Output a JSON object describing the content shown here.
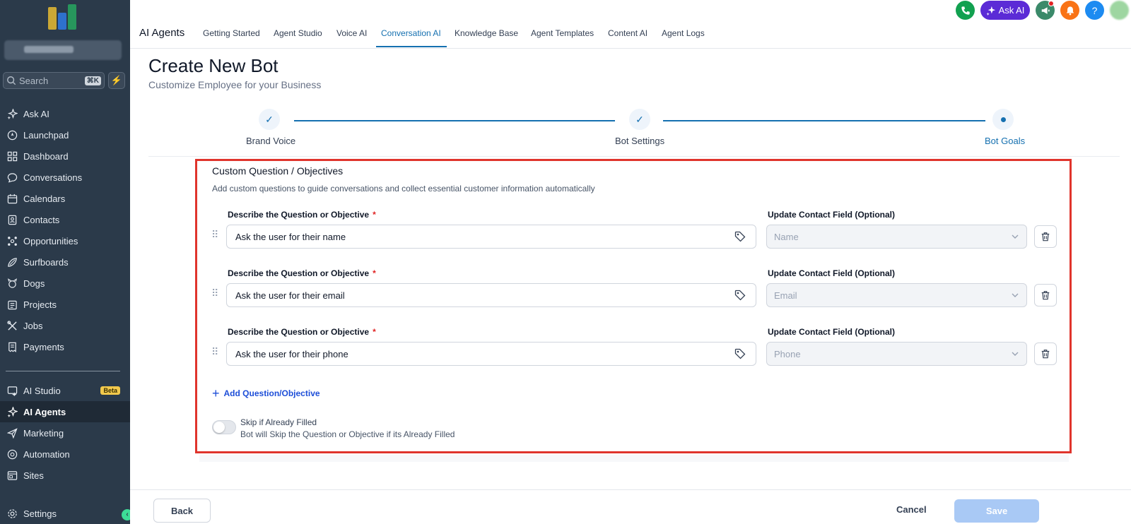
{
  "sidebar": {
    "search_placeholder": "Search",
    "search_shortcut": "⌘K",
    "items": [
      {
        "label": "Ask AI",
        "icon": "sparkle-icon"
      },
      {
        "label": "Launchpad",
        "icon": "rocket-icon"
      },
      {
        "label": "Dashboard",
        "icon": "dashboard-icon"
      },
      {
        "label": "Conversations",
        "icon": "chat-icon"
      },
      {
        "label": "Calendars",
        "icon": "calendar-icon"
      },
      {
        "label": "Contacts",
        "icon": "contacts-icon"
      },
      {
        "label": "Opportunities",
        "icon": "opportunities-icon"
      },
      {
        "label": "Surfboards",
        "icon": "surfboard-icon"
      },
      {
        "label": "Dogs",
        "icon": "dog-icon"
      },
      {
        "label": "Projects",
        "icon": "projects-icon"
      },
      {
        "label": "Jobs",
        "icon": "tools-icon"
      },
      {
        "label": "Payments",
        "icon": "receipt-icon"
      },
      {
        "label": "AI Studio",
        "icon": "ai-studio-icon",
        "badge": "Beta"
      },
      {
        "label": "AI Agents",
        "icon": "sparkle-icon"
      },
      {
        "label": "Marketing",
        "icon": "send-icon"
      },
      {
        "label": "Automation",
        "icon": "automation-icon"
      },
      {
        "label": "Sites",
        "icon": "sites-icon"
      },
      {
        "label": "Settings",
        "icon": "gear-icon"
      }
    ],
    "active_item": "AI Agents"
  },
  "header": {
    "title": "AI Agents",
    "tabs": [
      "Getting Started",
      "Agent Studio",
      "Voice AI",
      "Conversation AI",
      "Knowledge Base",
      "Agent Templates",
      "Content AI",
      "Agent Logs"
    ],
    "active_tab": "Conversation AI",
    "ask_ai_label": "Ask AI",
    "help_label": "?"
  },
  "page": {
    "title": "Create New Bot",
    "subtitle": "Customize Employee for your Business"
  },
  "stepper": {
    "steps": [
      {
        "label": "Brand Voice",
        "status": "completed"
      },
      {
        "label": "Bot Settings",
        "status": "completed"
      },
      {
        "label": "Bot Goals",
        "status": "current"
      }
    ]
  },
  "panel": {
    "title": "Custom Question / Objectives",
    "description": "Add custom questions to guide conversations and collect essential customer information automatically",
    "question_label": "Describe the Question or Objective",
    "required_mark": "*",
    "field_label": "Update Contact Field (Optional)",
    "questions": [
      {
        "value": "Ask the user for their name",
        "field": "Name"
      },
      {
        "value": "Ask the user for their email",
        "field": "Email"
      },
      {
        "value": "Ask the user for their phone",
        "field": "Phone"
      }
    ],
    "add_label": "Add Question/Objective",
    "toggle_label": "Skip if Already Filled",
    "toggle_help": "Bot will Skip the Question or Objective if its Already Filled"
  },
  "footer": {
    "back_label": "Back",
    "cancel_label": "Cancel",
    "save_label": "Save"
  },
  "colors": {
    "sidebar_bg": "#2b3a4a",
    "accent": "#1570b0",
    "highlight_outline": "#e0342c",
    "ask_ai": "#5b2bd6"
  }
}
